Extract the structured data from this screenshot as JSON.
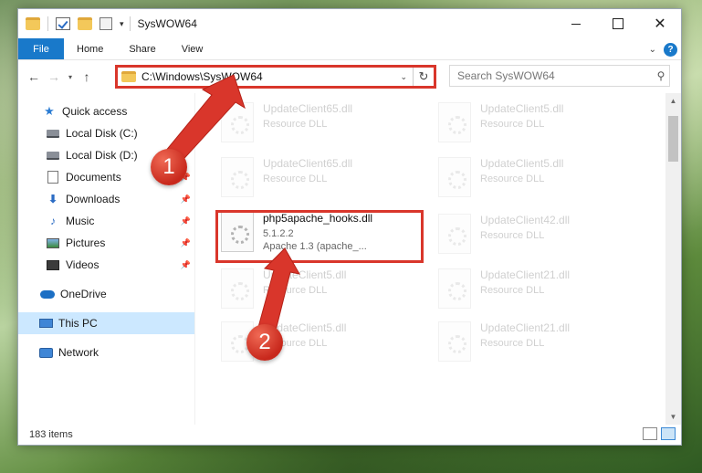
{
  "window": {
    "title": "SysWOW64"
  },
  "ribbon": {
    "tabs": [
      "File",
      "Home",
      "Share",
      "View"
    ],
    "help": "?"
  },
  "address": {
    "path": "C:\\Windows\\SysWOW64",
    "search_placeholder": "Search SysWOW64"
  },
  "sidebar": {
    "items": [
      {
        "label": "Quick access",
        "icon": "star-icon"
      },
      {
        "label": "Local Disk (C:)",
        "icon": "disk-icon"
      },
      {
        "label": "Local Disk (D:)",
        "icon": "disk-icon"
      },
      {
        "label": "Documents",
        "icon": "document-icon",
        "pinned": true
      },
      {
        "label": "Downloads",
        "icon": "download-icon",
        "pinned": true
      },
      {
        "label": "Music",
        "icon": "music-icon",
        "pinned": true
      },
      {
        "label": "Pictures",
        "icon": "picture-icon",
        "pinned": true
      },
      {
        "label": "Videos",
        "icon": "video-icon",
        "pinned": true
      },
      {
        "label": "OneDrive",
        "icon": "cloud-icon"
      },
      {
        "label": "This PC",
        "icon": "computer-icon",
        "selected": true
      },
      {
        "label": "Network",
        "icon": "network-icon"
      }
    ]
  },
  "files": {
    "background": [
      {
        "name": "UpdateClient65.dll",
        "sub": "Resource DLL"
      },
      {
        "name": "UpdateClient5.dll",
        "sub": "Resource DLL"
      },
      {
        "name": "UpdateClient65.dll",
        "sub": "Resource DLL"
      },
      {
        "name": "UpdateClient5.dll",
        "sub": "Resource DLL"
      },
      {
        "name": "UpdateClient42.dll",
        "sub": "Resource DLL"
      },
      {
        "name": "UpdateClient5.dll",
        "sub": "Resource DLL"
      },
      {
        "name": "UpdateClient21.dll",
        "sub": "Resource DLL"
      },
      {
        "name": "UpdateClient5.dll",
        "sub": "Resource DLL"
      },
      {
        "name": "UpdateClient21.dll",
        "sub": "Resource DLL"
      }
    ],
    "highlighted": {
      "name": "php5apache_hooks.dll",
      "version": "5.1.2.2",
      "description": "Apache 1.3 (apache_..."
    }
  },
  "status": {
    "item_count": "183 items"
  },
  "callouts": [
    "1",
    "2"
  ],
  "colors": {
    "accent": "#1979ca",
    "highlight": "#d9362b"
  }
}
